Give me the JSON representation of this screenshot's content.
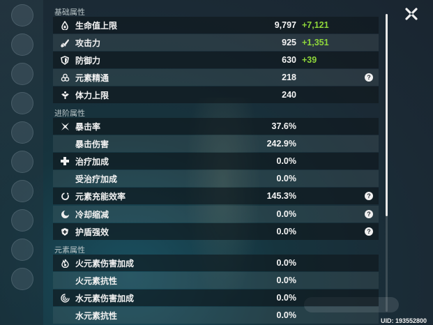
{
  "sections": [
    {
      "title": "基础属性"
    },
    {
      "title": "进阶属性"
    },
    {
      "title": "元素属性"
    }
  ],
  "stats": [
    {
      "icon": "hp-drop-icon",
      "label": "生命值上限",
      "value": "9,797",
      "bonus": "+7,121"
    },
    {
      "icon": "attack-sword-icon",
      "label": "攻击力",
      "value": "925",
      "bonus": "+1,351"
    },
    {
      "icon": "defense-shield-icon",
      "label": "防御力",
      "value": "630",
      "bonus": "+39"
    },
    {
      "icon": "elemental-mastery-icon",
      "label": "元素精通",
      "value": "218",
      "help": "?"
    },
    {
      "icon": "stamina-icon",
      "label": "体力上限",
      "value": "240"
    },
    {
      "icon": "crit-rate-icon",
      "label": "暴击率",
      "value": "37.6%"
    },
    {
      "label": "暴击伤害",
      "value": "242.9%"
    },
    {
      "icon": "healing-cross-icon",
      "label": "治疗加成",
      "value": "0.0%"
    },
    {
      "label": "受治疗加成",
      "value": "0.0%"
    },
    {
      "icon": "energy-recharge-icon",
      "label": "元素充能效率",
      "value": "145.3%",
      "help": "?"
    },
    {
      "icon": "cooldown-icon",
      "label": "冷却缩减",
      "value": "0.0%",
      "help": "?"
    },
    {
      "icon": "shield-strength-icon",
      "label": "护盾强效",
      "value": "0.0%",
      "help": "?"
    },
    {
      "icon": "pyro-icon",
      "label": "火元素伤害加成",
      "value": "0.0%"
    },
    {
      "label": "火元素抗性",
      "value": "0.0%"
    },
    {
      "icon": "hydro-icon",
      "label": "水元素伤害加成",
      "value": "0.0%"
    },
    {
      "label": "水元素抗性",
      "value": "0.0%"
    }
  ],
  "uid_text": "UID: 193552800",
  "colors": {
    "bonus": "#8fd73a",
    "row_dark": "#0e161c",
    "text": "#f2f2f2"
  }
}
